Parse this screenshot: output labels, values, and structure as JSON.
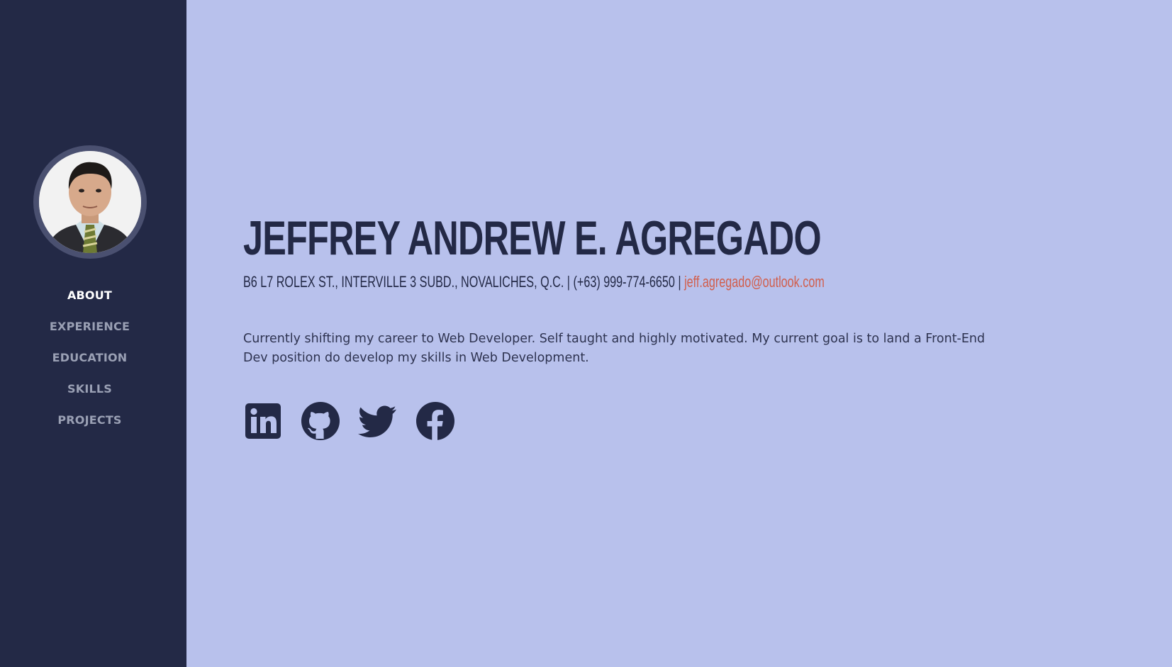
{
  "sidebar": {
    "nav": [
      {
        "label": "ABOUT",
        "active": true
      },
      {
        "label": "EXPERIENCE",
        "active": false
      },
      {
        "label": "EDUCATION",
        "active": false
      },
      {
        "label": "SKILLS",
        "active": false
      },
      {
        "label": "PROJECTS",
        "active": false
      }
    ]
  },
  "header": {
    "name": "JEFFREY ANDREW E. AGREGADO",
    "contact_prefix": "B6 L7 ROLEX ST., INTERVILLE 3 SUBD., NOVALICHES, Q.C. | (+63) 999-774-6650 | ",
    "email": "jeff.agregado@outlook.com"
  },
  "about": {
    "bio": "Currently shifting my career to Web Developer. Self taught and highly motivated. My current goal is to land a Front-End Dev position do develop my skills in Web Development."
  },
  "socials": [
    {
      "icon": "linkedin-icon"
    },
    {
      "icon": "github-icon"
    },
    {
      "icon": "twitter-icon"
    },
    {
      "icon": "facebook-icon"
    }
  ],
  "colors": {
    "sidebar_bg": "#232946",
    "main_bg": "#b8c1ec",
    "text": "#232946",
    "accent": "#d15e4c"
  }
}
